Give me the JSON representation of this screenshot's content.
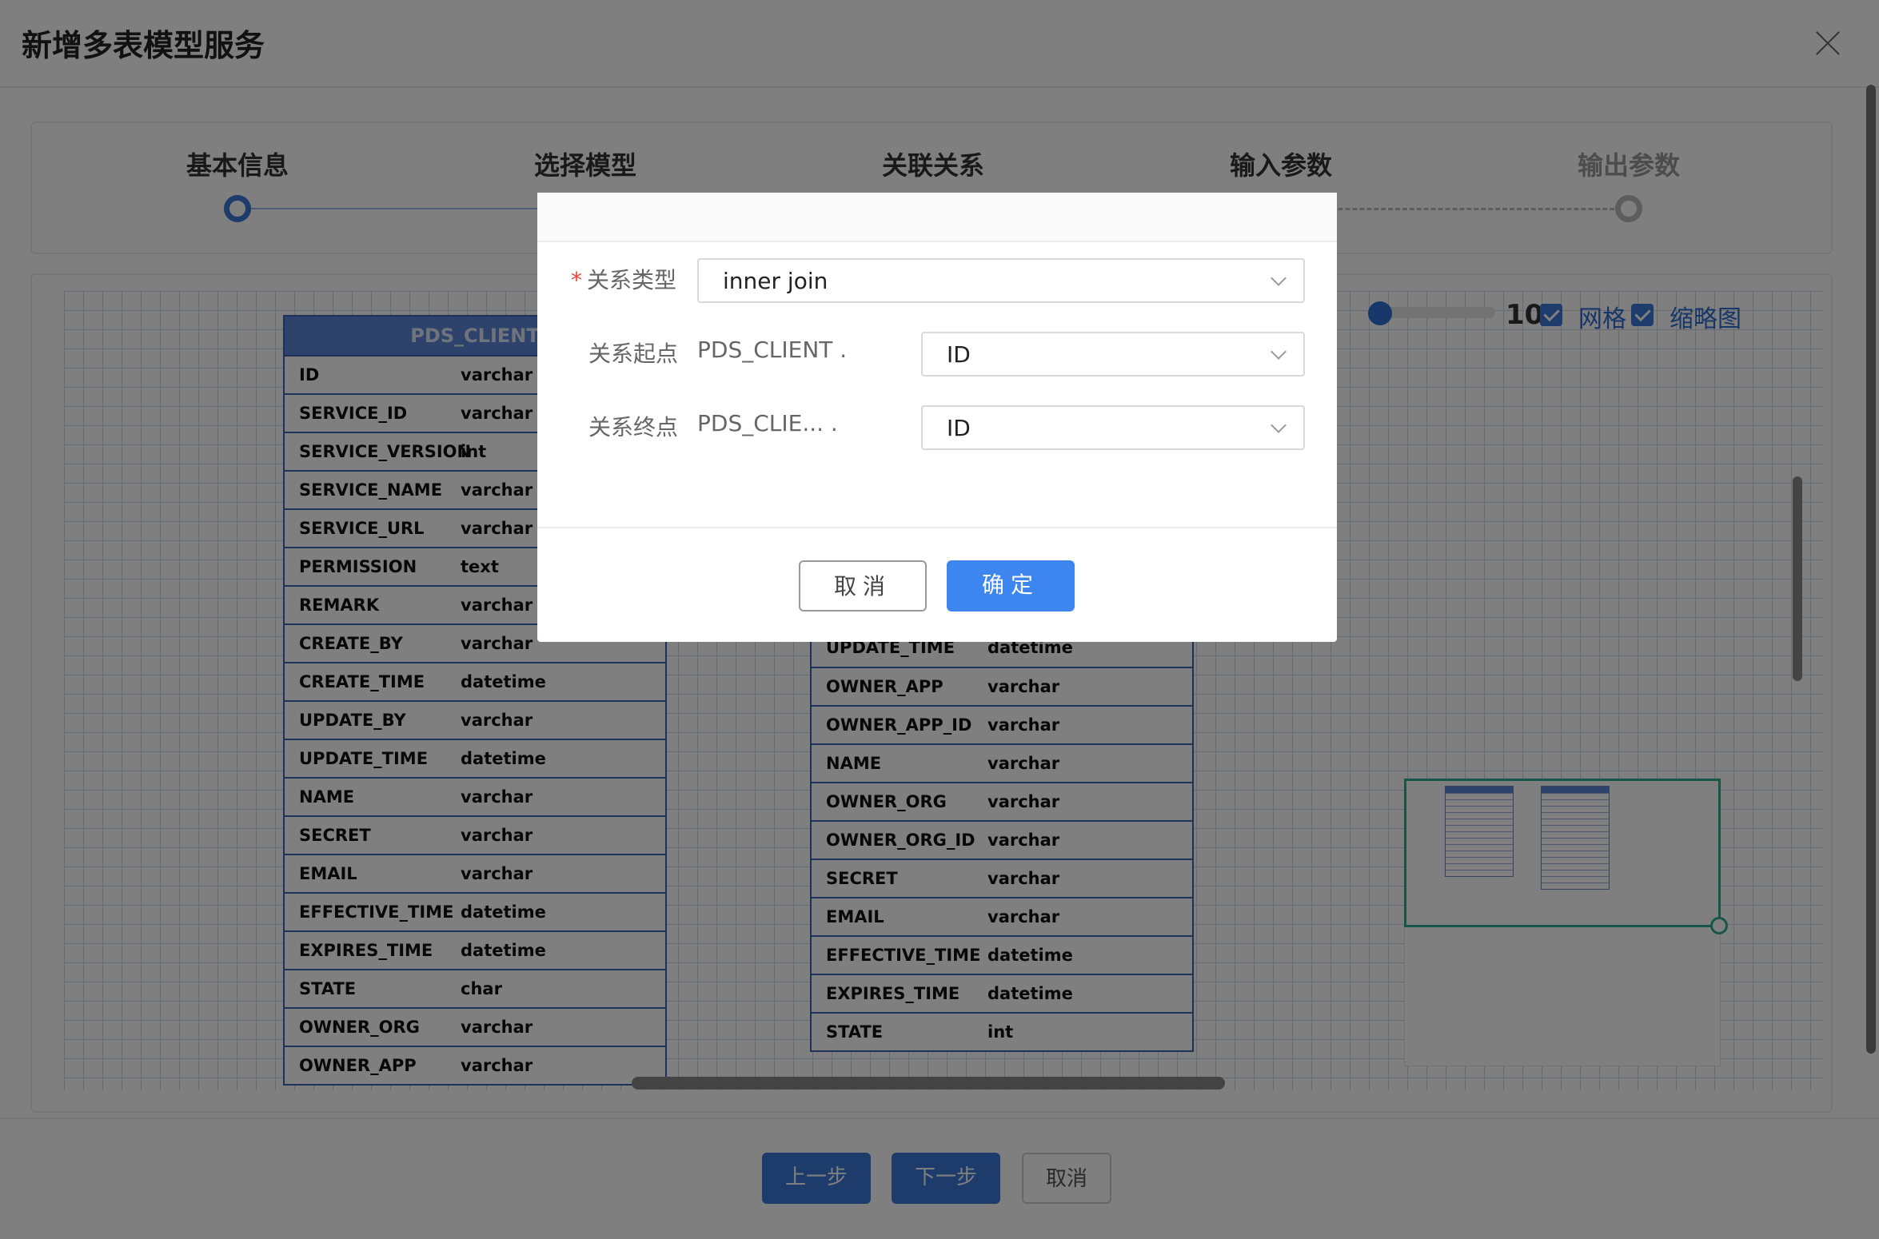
{
  "dialog": {
    "title": "新增多表模型服务"
  },
  "steps": [
    {
      "label": "基本信息"
    },
    {
      "label": "选择模型"
    },
    {
      "label": "关联关系"
    },
    {
      "label": "输入参数"
    },
    {
      "label": "输出参数"
    }
  ],
  "toolbar": {
    "zoom_value": "10",
    "grid_label": "网格",
    "minimap_label": "缩略图"
  },
  "left_table": {
    "title": "PDS_CLIENT",
    "rows": [
      {
        "name": "ID",
        "type": "varchar"
      },
      {
        "name": "SERVICE_ID",
        "type": "varchar"
      },
      {
        "name": "SERVICE_VERSION",
        "type": "int"
      },
      {
        "name": "SERVICE_NAME",
        "type": "varchar"
      },
      {
        "name": "SERVICE_URL",
        "type": "varchar"
      },
      {
        "name": "PERMISSION",
        "type": "text"
      },
      {
        "name": "REMARK",
        "type": "varchar"
      },
      {
        "name": "CREATE_BY",
        "type": "varchar"
      },
      {
        "name": "CREATE_TIME",
        "type": "datetime"
      },
      {
        "name": "UPDATE_BY",
        "type": "varchar"
      },
      {
        "name": "UPDATE_TIME",
        "type": "datetime"
      },
      {
        "name": "NAME",
        "type": "varchar"
      },
      {
        "name": "SECRET",
        "type": "varchar"
      },
      {
        "name": "EMAIL",
        "type": "varchar"
      },
      {
        "name": "EFFECTIVE_TIME",
        "type": "datetime"
      },
      {
        "name": "EXPIRES_TIME",
        "type": "datetime"
      },
      {
        "name": "STATE",
        "type": "char"
      },
      {
        "name": "OWNER_ORG",
        "type": "varchar"
      },
      {
        "name": "OWNER_APP",
        "type": "varchar"
      }
    ]
  },
  "right_table": {
    "rows": [
      {
        "name": "UPDATE_TIME",
        "type": "datetime"
      },
      {
        "name": "OWNER_APP",
        "type": "varchar"
      },
      {
        "name": "OWNER_APP_ID",
        "type": "varchar"
      },
      {
        "name": "NAME",
        "type": "varchar"
      },
      {
        "name": "OWNER_ORG",
        "type": "varchar"
      },
      {
        "name": "OWNER_ORG_ID",
        "type": "varchar"
      },
      {
        "name": "SECRET",
        "type": "varchar"
      },
      {
        "name": "EMAIL",
        "type": "varchar"
      },
      {
        "name": "EFFECTIVE_TIME",
        "type": "datetime"
      },
      {
        "name": "EXPIRES_TIME",
        "type": "datetime"
      },
      {
        "name": "STATE",
        "type": "int"
      }
    ]
  },
  "footer": {
    "prev_label": "上一步",
    "next_label": "下一步",
    "cancel_label": "取消"
  },
  "modal": {
    "relation_type_label": "关系类型",
    "relation_type_value": "inner join",
    "start_label": "关系起点",
    "start_prefix": "PDS_CLIENT .",
    "start_value": "ID",
    "end_label": "关系终点",
    "end_prefix": "PDS_CLIE... .",
    "end_value": "ID",
    "cancel_label": "取消",
    "ok_label": "确定"
  }
}
